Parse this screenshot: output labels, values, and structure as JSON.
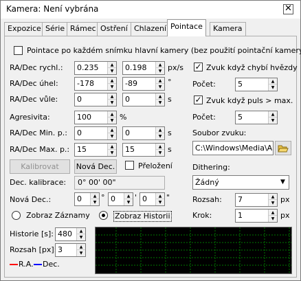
{
  "window": {
    "title": "Kamera: Není vybrána",
    "close_label": "✕"
  },
  "tabs": [
    "Expozice",
    "Série",
    "Rámec",
    "Ostření",
    "Chlazení",
    "Pointace",
    "Kamera"
  ],
  "active_tab": "Pointace",
  "pointace": {
    "guide_after_each_frame": {
      "checked": false,
      "label": "Pointace po každém snímku hlavní kamery (bez použití pointační kamery)"
    },
    "ra_dec_speed": {
      "label": "RA/Dec rychl.:",
      "ra": "0.235",
      "dec": "0.198",
      "unit": "px/s"
    },
    "ra_dec_angle": {
      "label": "RA/Dec úhel:",
      "ra": "-178",
      "dec": "-89",
      "unit": "°"
    },
    "ra_dec_backlash": {
      "label": "RA/Dec vůle:",
      "ra": "0",
      "dec": "0",
      "unit": "s"
    },
    "aggressivity": {
      "label": "Agresivita:",
      "value": "100",
      "unit": "%"
    },
    "ra_dec_min": {
      "label": "RA/Dec Min. p.:",
      "ra": "0",
      "dec": "0",
      "unit": "s"
    },
    "ra_dec_max": {
      "label": "RA/Dec Max. p.:",
      "ra": "15",
      "dec": "15",
      "unit": "s"
    },
    "calibrate_label": "Kalibrovat",
    "new_dec_label": "Nová Dec.",
    "flip": {
      "checked": false,
      "label": "Přeložení"
    },
    "dec_calibration": {
      "label": "Dec. kalibrace:",
      "value": "0° 00' 00\""
    },
    "new_dec": {
      "label": "Nová Dec.:",
      "deg": "0",
      "min": "0",
      "sec": "0",
      "deg_unit": "°",
      "min_unit": "'",
      "sec_unit": "\""
    },
    "show_records": {
      "selected": false,
      "label": "Zobraz Záznamy"
    },
    "show_history": {
      "selected": true,
      "label": "Zobraz Historii"
    },
    "history": {
      "label": "Historie [s]:",
      "value": "480"
    },
    "range_px": {
      "label": "Rozsah [px]:",
      "value": "3"
    },
    "legend": {
      "ra": "R.A.",
      "dec": "Dec."
    },
    "sound_missing_star": {
      "checked": true,
      "label": "Zvuk když chybí hvězdy",
      "count_label": "Počet:",
      "count": "5"
    },
    "sound_pulse_over_max": {
      "checked": true,
      "label": "Zvuk když puls > max.",
      "count_label": "Počet:",
      "count": "5"
    },
    "sound_file": {
      "label": "Soubor zvuku:",
      "value": "C:\\Windows\\Media\\A"
    },
    "dithering": {
      "label": "Dithering:",
      "value": "Žádný"
    },
    "dither_range": {
      "label": "Rozsah:",
      "value": "7",
      "unit": "px"
    },
    "dither_step": {
      "label": "Krok:",
      "value": "1",
      "unit": "px"
    }
  },
  "colors": {
    "ra_line": "#ff0000",
    "dec_line": "#0000ff",
    "chart_bg": "#000000",
    "chart_grid": "#007a00"
  }
}
